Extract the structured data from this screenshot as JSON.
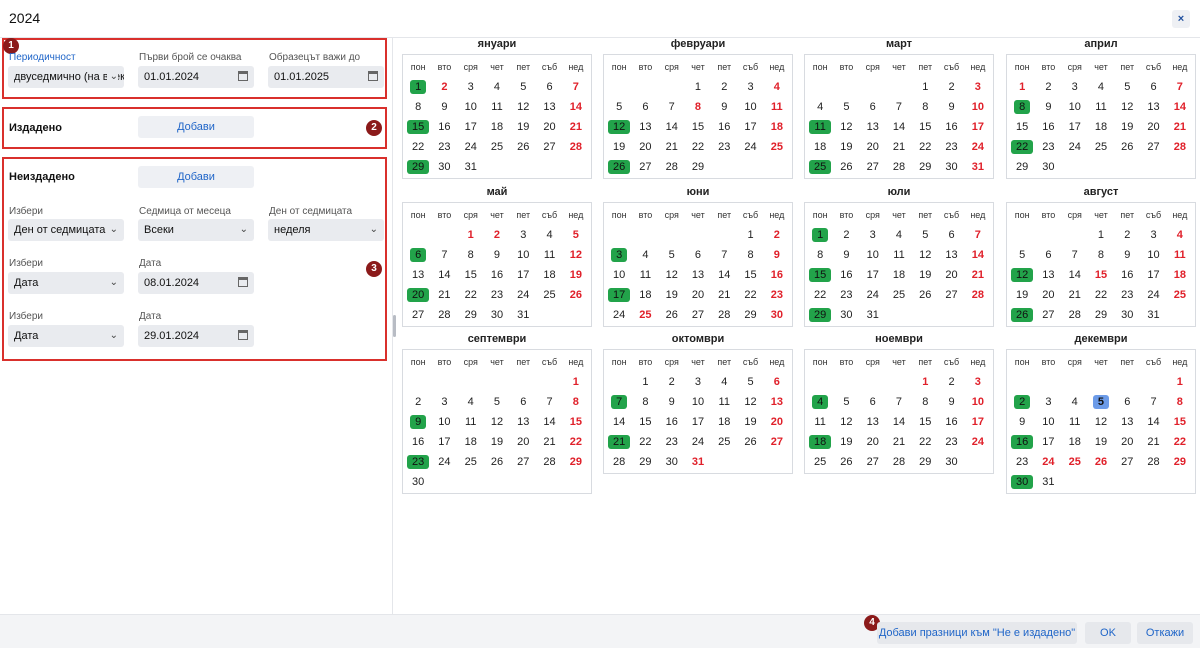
{
  "window": {
    "title": "2024",
    "close_label": "×"
  },
  "periodicity": {
    "label": "Периодичност",
    "value": "двуседмично (на всеки две седмици)",
    "first_label": "Първи брой се очаква",
    "first_value": "01.01.2024",
    "valid_label": "Образецът важи до",
    "valid_value": "01.01.2025"
  },
  "issued": {
    "title": "Издадено",
    "add_label": "Добави"
  },
  "not_issued": {
    "title": "Неиздадено",
    "add_label": "Добави",
    "rows": [
      {
        "select_label": "Избери",
        "select_value": "Ден от седмицата",
        "week_label": "Седмица от месеца",
        "week_value": "Всеки",
        "day_label": "Ден от седмицата",
        "day_value": "неделя"
      },
      {
        "select_label": "Избери",
        "select_value": "Дата",
        "date_label": "Дата",
        "date_value": "08.01.2024"
      },
      {
        "select_label": "Избери",
        "select_value": "Дата",
        "date_label": "Дата",
        "date_value": "29.01.2024"
      }
    ]
  },
  "badges": [
    "1",
    "2",
    "3",
    "4"
  ],
  "weekdays": [
    "пон",
    "вто",
    "сря",
    "чет",
    "пет",
    "съб",
    "нед"
  ],
  "months": [
    {
      "name": "януари",
      "first": 0,
      "days": 31,
      "red": [
        2,
        7,
        14,
        21,
        28
      ],
      "green": [
        1,
        15,
        29
      ],
      "blue": []
    },
    {
      "name": "февруари",
      "first": 3,
      "days": 29,
      "red": [
        4,
        8,
        11,
        18,
        25
      ],
      "green": [
        12,
        26
      ],
      "blue": []
    },
    {
      "name": "март",
      "first": 4,
      "days": 31,
      "red": [
        3,
        10,
        17,
        24,
        31
      ],
      "green": [
        11,
        25
      ],
      "blue": []
    },
    {
      "name": "април",
      "first": 0,
      "days": 30,
      "red": [
        1,
        7,
        14,
        21,
        28
      ],
      "green": [
        8,
        22
      ],
      "blue": []
    },
    {
      "name": "май",
      "first": 2,
      "days": 31,
      "red": [
        1,
        2,
        5,
        12,
        19,
        26
      ],
      "green": [
        6,
        20
      ],
      "blue": []
    },
    {
      "name": "юни",
      "first": 5,
      "days": 30,
      "red": [
        2,
        9,
        16,
        23,
        25,
        30
      ],
      "green": [
        3,
        17
      ],
      "blue": []
    },
    {
      "name": "юли",
      "first": 0,
      "days": 31,
      "red": [
        7,
        14,
        21,
        28
      ],
      "green": [
        1,
        15,
        29
      ],
      "blue": []
    },
    {
      "name": "август",
      "first": 3,
      "days": 31,
      "red": [
        4,
        11,
        15,
        18,
        25
      ],
      "green": [
        12,
        26
      ],
      "blue": []
    },
    {
      "name": "септември",
      "first": 6,
      "days": 30,
      "red": [
        1,
        8,
        15,
        22,
        29
      ],
      "green": [
        9,
        23
      ],
      "blue": []
    },
    {
      "name": "октомври",
      "first": 1,
      "days": 31,
      "red": [
        6,
        13,
        20,
        27,
        31
      ],
      "green": [
        7,
        21
      ],
      "blue": []
    },
    {
      "name": "ноември",
      "first": 4,
      "days": 30,
      "red": [
        1,
        3,
        10,
        17,
        24
      ],
      "green": [
        4,
        18
      ],
      "blue": []
    },
    {
      "name": "декември",
      "first": 6,
      "days": 31,
      "red": [
        1,
        8,
        15,
        22,
        24,
        25,
        26,
        29
      ],
      "green": [
        2,
        16,
        30
      ],
      "blue": [
        5
      ]
    }
  ],
  "footer": {
    "add_holidays_label": "Добави празници към \"Не е издадено\"",
    "ok_label": "OK",
    "cancel_label": "Откажи"
  },
  "colors": {
    "accent": "#1f65c8",
    "highlight_red": "#d9302c",
    "issued_green": "#22a34a",
    "today_blue": "#6c9be8",
    "weekend_red": "#e0202a"
  }
}
